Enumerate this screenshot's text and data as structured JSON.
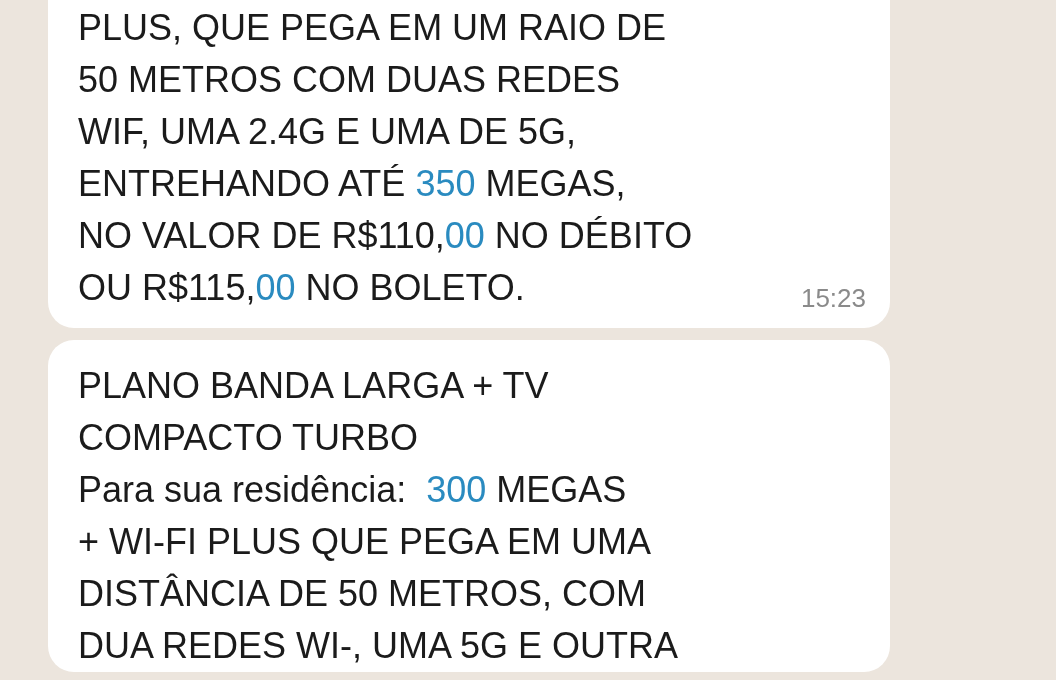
{
  "messages": [
    {
      "lines": [
        [
          {
            "text": "PLUS, QUE PEGA EM UM RAIO DE",
            "link": false
          }
        ],
        [
          {
            "text": "50 METROS COM DUAS REDES",
            "link": false
          }
        ],
        [
          {
            "text": "WIF, UMA 2.4G E UMA DE 5G,",
            "link": false
          }
        ],
        [
          {
            "text": "ENTREHANDO ATÉ ",
            "link": false
          },
          {
            "text": "350",
            "link": true
          },
          {
            "text": " MEGAS,",
            "link": false
          }
        ],
        [
          {
            "text": "NO VALOR DE R$110,",
            "link": false
          },
          {
            "text": "00",
            "link": true
          },
          {
            "text": " NO DÉBITO",
            "link": false
          }
        ],
        [
          {
            "text": "OU R$115,",
            "link": false
          },
          {
            "text": "00",
            "link": true
          },
          {
            "text": " NO BOLETO.",
            "link": false
          }
        ]
      ],
      "time": "15:23"
    },
    {
      "lines": [
        [
          {
            "text": "PLANO BANDA LARGA + TV",
            "link": false
          }
        ],
        [
          {
            "text": "COMPACTO TURBO",
            "link": false
          }
        ],
        [
          {
            "text": "Para sua residência:  ",
            "link": false
          },
          {
            "text": "300",
            "link": true
          },
          {
            "text": " MEGAS",
            "link": false
          }
        ],
        [
          {
            "text": "+ WI-FI PLUS QUE PEGA EM UMA",
            "link": false
          }
        ],
        [
          {
            "text": "DISTÂNCIA DE 50 METROS, COM",
            "link": false
          }
        ],
        [
          {
            "text": "DUA REDES WI-, UMA 5G E OUTRA",
            "link": false
          }
        ]
      ]
    }
  ]
}
